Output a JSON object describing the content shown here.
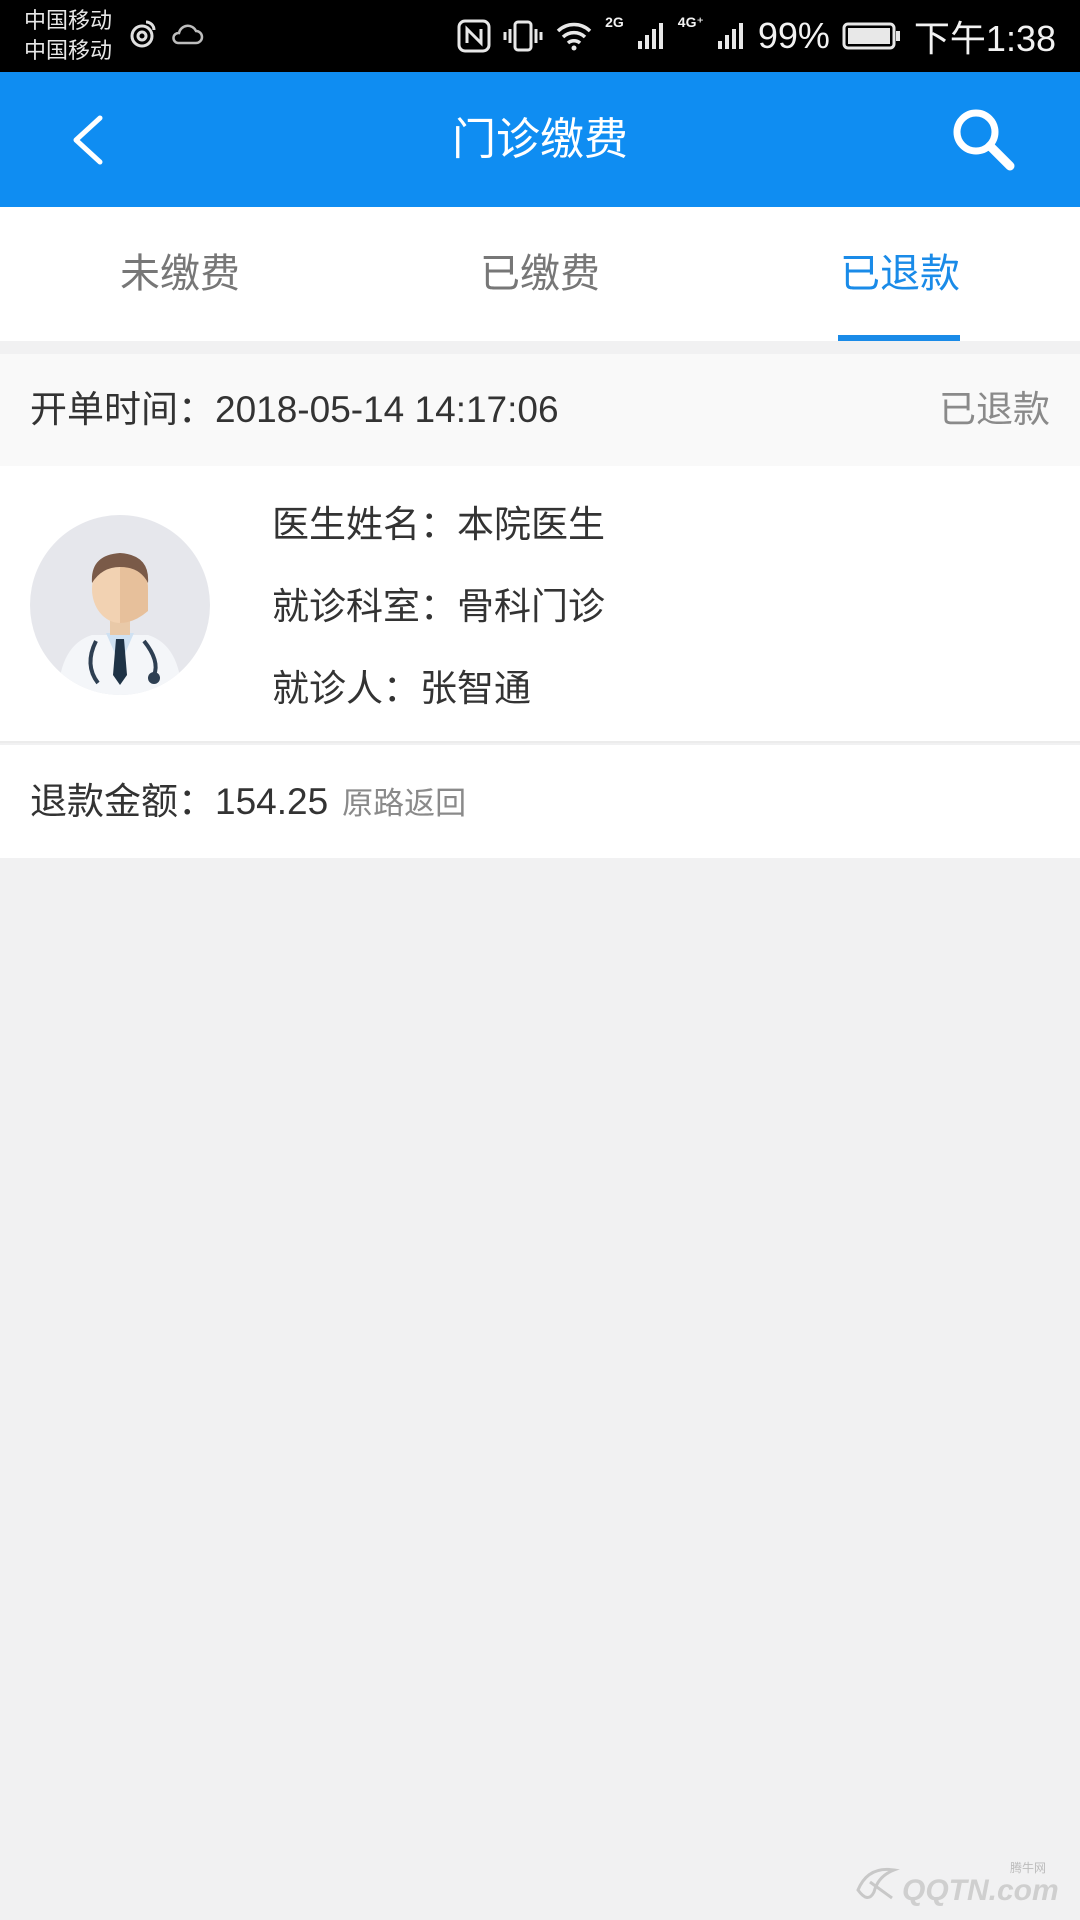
{
  "status_bar": {
    "carrier_1": "中国移动",
    "carrier_2": "中国移动",
    "network_1": "2G",
    "network_2": "4G⁺",
    "battery": "99%",
    "time": "下午1:38"
  },
  "header": {
    "title": "门诊缴费"
  },
  "tabs": [
    {
      "label": "未缴费"
    },
    {
      "label": "已缴费"
    },
    {
      "label": "已退款"
    }
  ],
  "active_tab_index": 2,
  "order": {
    "time_label": "开单时间：",
    "time_value": "2018-05-14 14:17:06",
    "status": "已退款",
    "doctor_label": "医生姓名：",
    "doctor_name": "本院医生",
    "department_label": "就诊科室：",
    "department": "骨科门诊",
    "patient_label": "就诊人：",
    "patient": "张智通",
    "refund_label": "退款金额：",
    "refund_amount": "154.25",
    "refund_method": "原路返回"
  },
  "watermark": {
    "text": "QQTN.com",
    "small": "腾牛网"
  },
  "colors": {
    "header": "#0f8df2",
    "accent": "#1a8be8",
    "background": "#f1f1f2"
  }
}
